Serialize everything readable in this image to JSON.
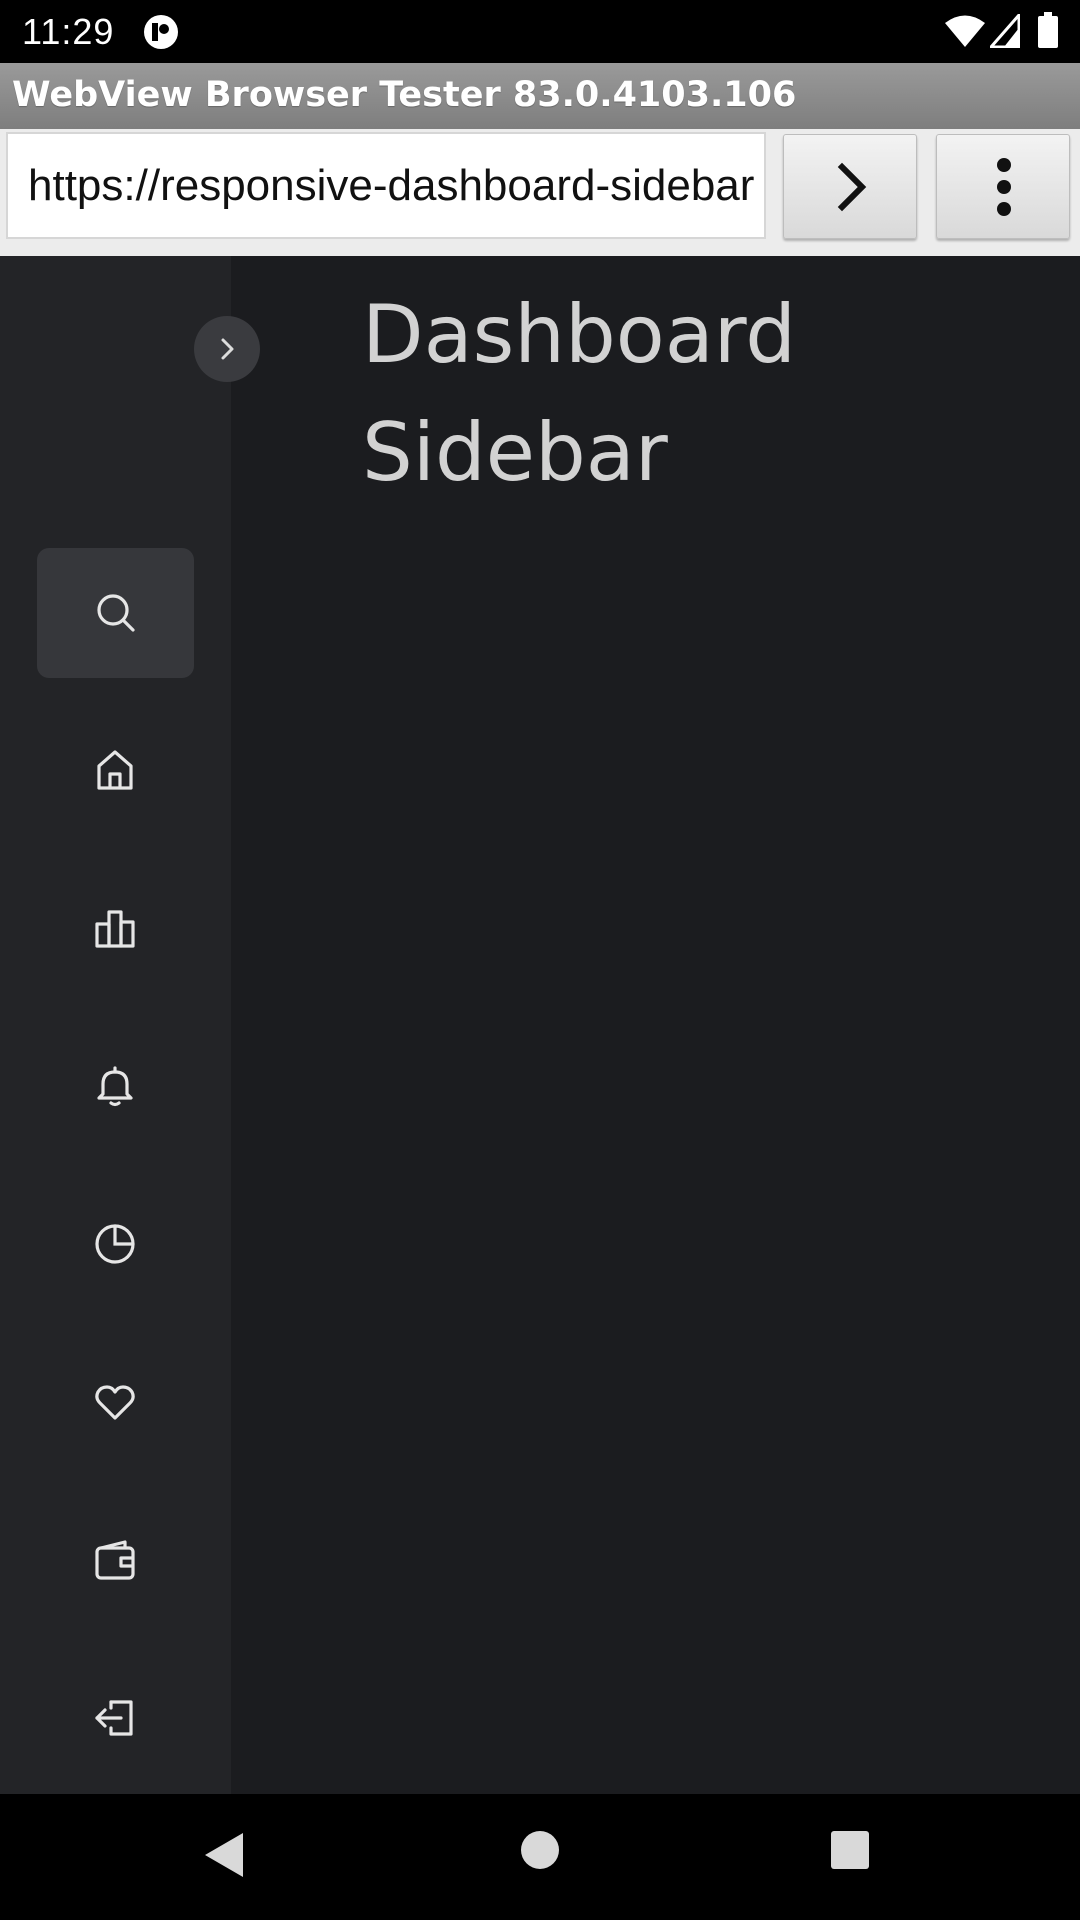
{
  "status_bar": {
    "time": "11:29",
    "icons": [
      "app-notification-icon",
      "wifi-icon",
      "signal-icon",
      "battery-icon"
    ]
  },
  "app": {
    "title": "WebView Browser Tester 83.0.4103.106"
  },
  "url_bar": {
    "url": "https://responsive-dashboard-sidebar",
    "go_icon": "chevron-right-icon",
    "menu_icon": "more-vertical-icon"
  },
  "page": {
    "heading": "Dashboard Sidebar",
    "toggle_icon": "chevron-right-icon",
    "sidebar_items": [
      {
        "icon": "search-icon",
        "active": true
      },
      {
        "icon": "home-icon",
        "active": false
      },
      {
        "icon": "bar-chart-icon",
        "active": false
      },
      {
        "icon": "bell-icon",
        "active": false
      },
      {
        "icon": "pie-chart-icon",
        "active": false
      },
      {
        "icon": "heart-icon",
        "active": false
      },
      {
        "icon": "wallet-icon",
        "active": false
      },
      {
        "icon": "logout-icon",
        "active": false
      }
    ]
  },
  "nav_bar": {
    "icons": [
      "back-icon",
      "home-circle-icon",
      "recents-icon"
    ]
  },
  "colors": {
    "content_bg": "#1b1c1f",
    "sidebar_bg": "#232427",
    "active_item_bg": "#36373b",
    "heading_text": "#d2d2d2",
    "icon_stroke": "#e6e6e6"
  }
}
